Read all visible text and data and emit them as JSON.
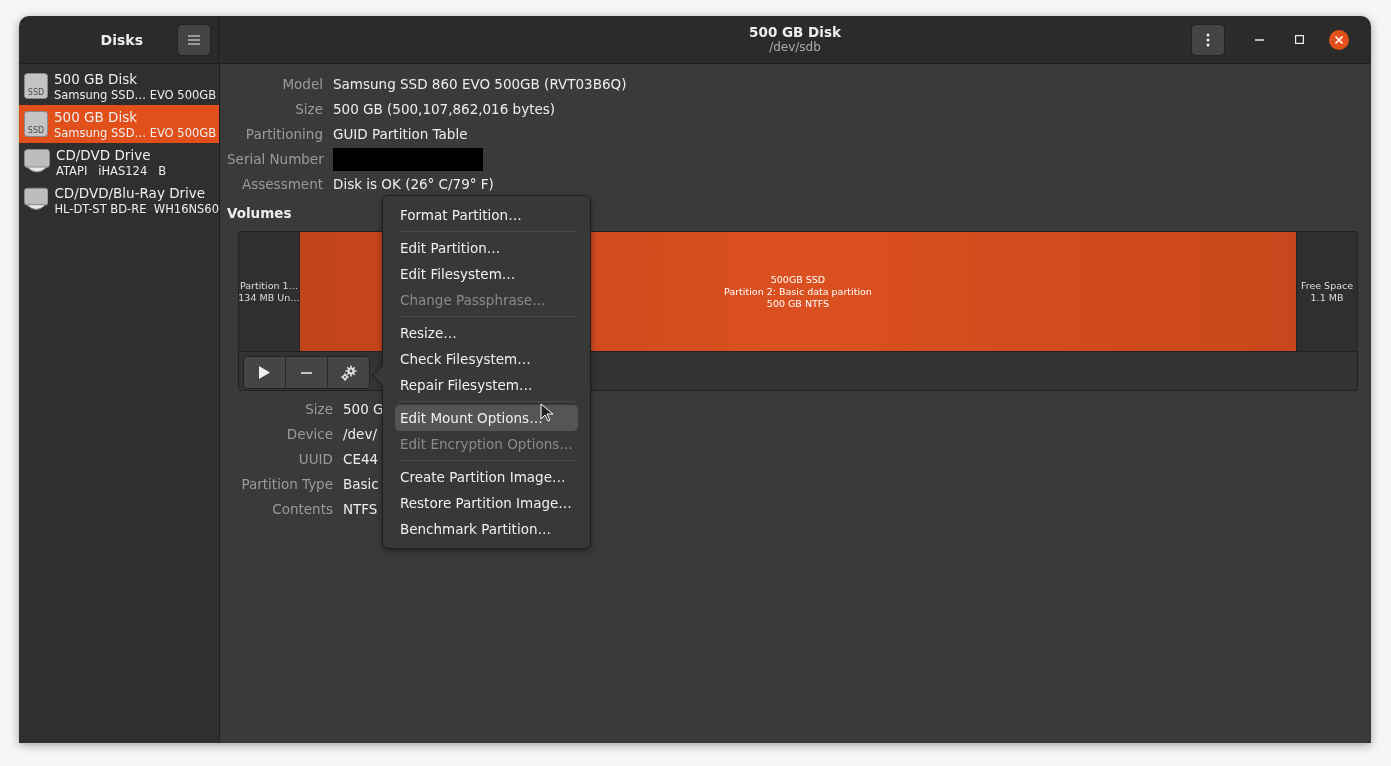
{
  "sidebar": {
    "title": "Disks",
    "items": [
      {
        "name": "500 GB Disk",
        "subtitle": "Samsung SSD… EVO 500GB",
        "kind": "ssd",
        "icon_label": "SSD",
        "selected": false
      },
      {
        "name": "500 GB Disk",
        "subtitle": "Samsung SSD… EVO 500GB",
        "kind": "ssd",
        "icon_label": "SSD",
        "selected": true
      },
      {
        "name": "CD/DVD Drive",
        "subtitle": "ATAPI   iHAS124   B",
        "kind": "optical",
        "selected": false
      },
      {
        "name": "CD/DVD/Blu-Ray Drive",
        "subtitle": "HL-DT-ST BD-RE  WH16NS60",
        "kind": "optical",
        "selected": false
      }
    ]
  },
  "header": {
    "title": "500 GB Disk",
    "subtitle": "/dev/sdb"
  },
  "disk_details": [
    {
      "label": "Model",
      "value": "Samsung SSD 860 EVO 500GB (RVT03B6Q)"
    },
    {
      "label": "Size",
      "value": "500 GB (500,107,862,016 bytes)"
    },
    {
      "label": "Partitioning",
      "value": "GUID Partition Table"
    },
    {
      "label": "Serial Number",
      "redacted": true
    },
    {
      "label": "Assessment",
      "value": "Disk is OK (26° C/79° F)"
    }
  ],
  "volumes": {
    "title": "Volumes",
    "partitions": [
      {
        "lines": [
          "Partition 1…",
          "134 MB Un…"
        ],
        "selected": false
      },
      {
        "lines": [
          "500GB SSD",
          "Partition 2: Basic data partition",
          "500 GB NTFS"
        ],
        "selected": true
      },
      {
        "lines": [
          "Free Space",
          "1.1 MB"
        ],
        "selected": false
      }
    ]
  },
  "partition_details": [
    {
      "label": "Size",
      "value": "500 G"
    },
    {
      "label": "Device",
      "value": "/dev/"
    },
    {
      "label": "UUID",
      "value": "CE44"
    },
    {
      "label": "Partition Type",
      "value": "Basic"
    },
    {
      "label": "Contents",
      "value": "NTFS"
    }
  ],
  "context_menu": {
    "groups": [
      [
        {
          "label": "Format Partition…",
          "disabled": false,
          "selected": false
        }
      ],
      [
        {
          "label": "Edit Partition…",
          "disabled": false,
          "selected": false
        },
        {
          "label": "Edit Filesystem…",
          "disabled": false,
          "selected": false
        },
        {
          "label": "Change Passphrase…",
          "disabled": true,
          "selected": false
        }
      ],
      [
        {
          "label": "Resize…",
          "disabled": false,
          "selected": false
        },
        {
          "label": "Check Filesystem…",
          "disabled": false,
          "selected": false
        },
        {
          "label": "Repair Filesystem…",
          "disabled": false,
          "selected": false
        }
      ],
      [
        {
          "label": "Edit Mount Options…",
          "disabled": false,
          "selected": true
        },
        {
          "label": "Edit Encryption Options…",
          "disabled": true,
          "selected": false
        }
      ],
      [
        {
          "label": "Create Partition Image…",
          "disabled": false,
          "selected": false
        },
        {
          "label": "Restore Partition Image…",
          "disabled": false,
          "selected": false
        },
        {
          "label": "Benchmark Partition…",
          "disabled": false,
          "selected": false
        }
      ]
    ]
  }
}
